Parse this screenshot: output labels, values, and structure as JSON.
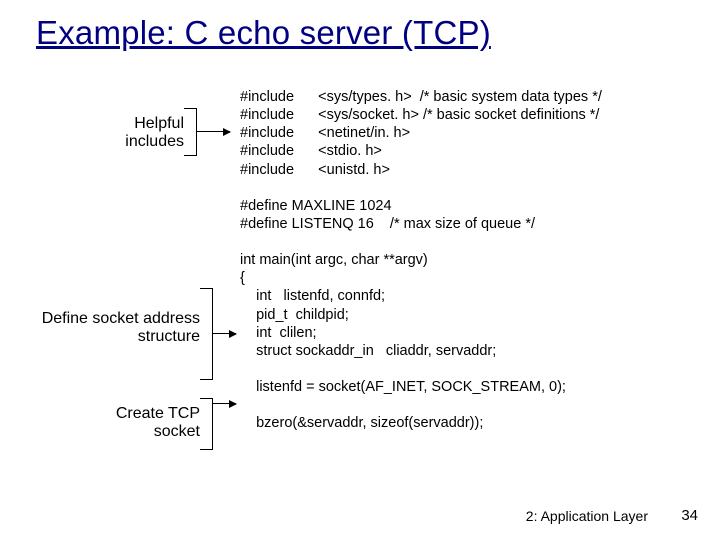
{
  "title": "Example: C echo server (TCP)",
  "annotations": {
    "helpful": "Helpful\nincludes",
    "define": "Define socket\naddress structure",
    "create": "Create\nTCP socket"
  },
  "code": "#include      <sys/types. h>  /* basic system data types */\n#include      <sys/socket. h> /* basic socket definitions */\n#include      <netinet/in. h>\n#include      <stdio. h>\n#include      <unistd. h>\n\n#define MAXLINE 1024\n#define LISTENQ 16    /* max size of queue */\n\nint main(int argc, char **argv)\n{\n    int   listenfd, connfd;\n    pid_t  childpid;\n    int  clilen;\n    struct sockaddr_in   cliaddr, servaddr;\n\n    listenfd = socket(AF_INET, SOCK_STREAM, 0);\n\n    bzero(&servaddr, sizeof(servaddr));",
  "footer": {
    "label": "2: Application Layer",
    "page": "34"
  }
}
